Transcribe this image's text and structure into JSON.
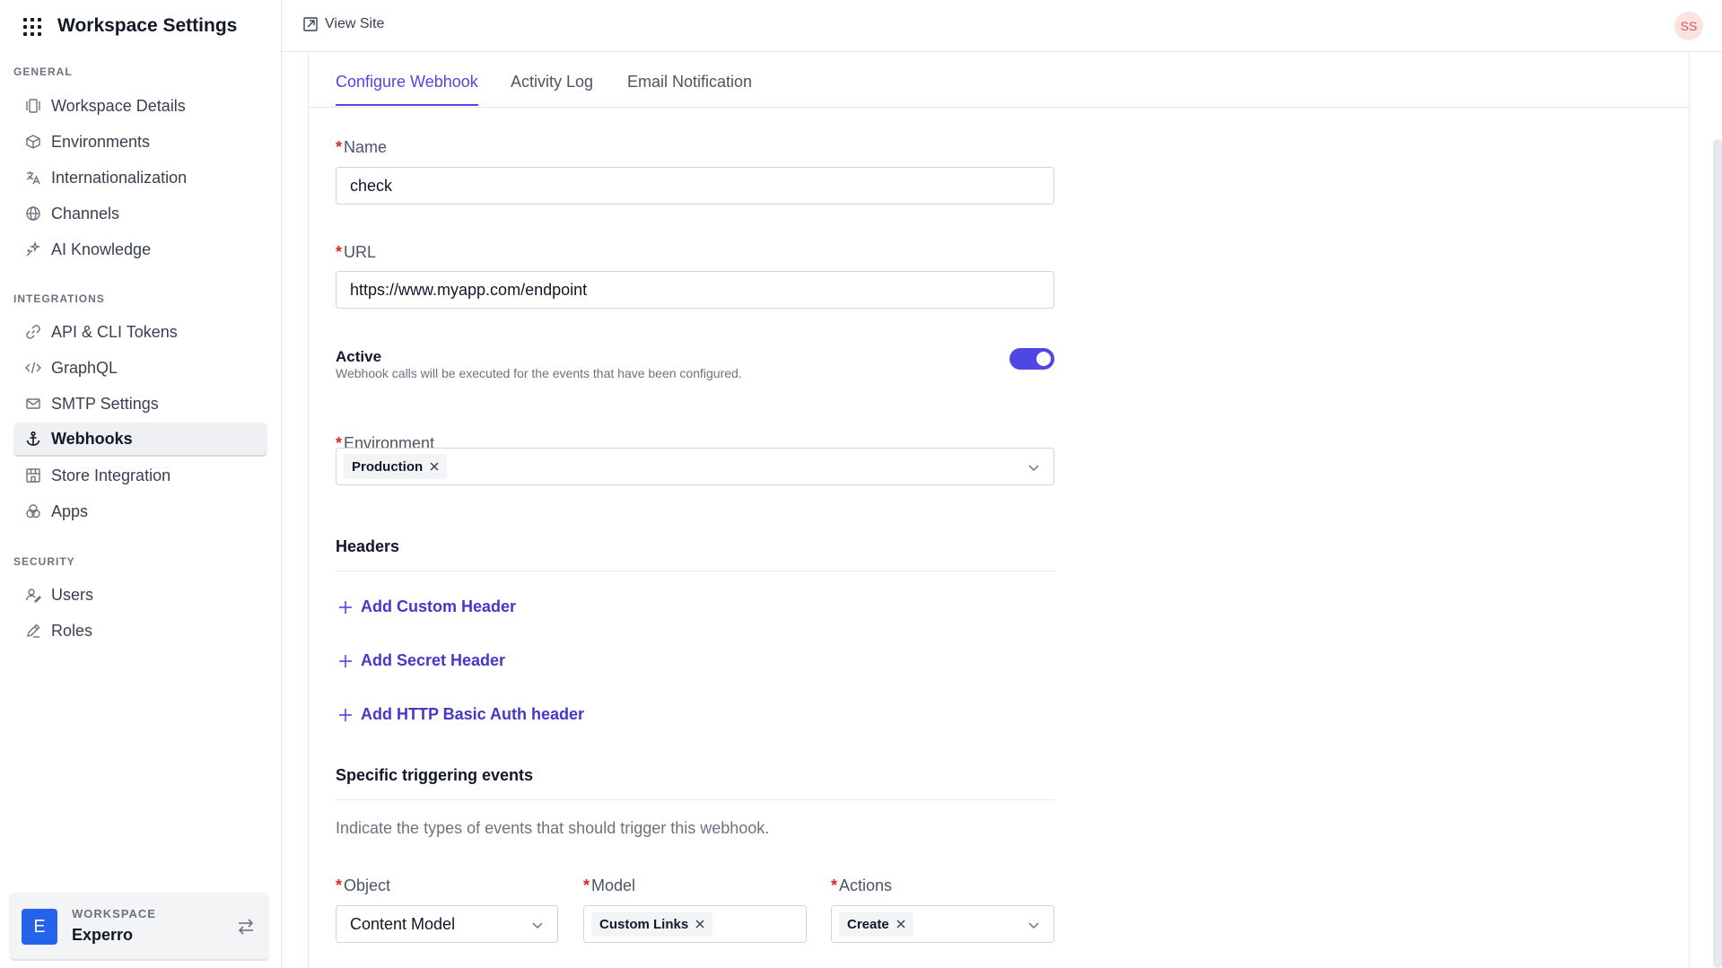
{
  "sidebar": {
    "title": "Workspace Settings",
    "sections": {
      "general": "GENERAL",
      "integrations": "INTEGRATIONS",
      "security": "SECURITY"
    },
    "items": [
      {
        "label": "Workspace Details",
        "icon": "panels-icon"
      },
      {
        "label": "Environments",
        "icon": "cube-icon"
      },
      {
        "label": "Internationalization",
        "icon": "translate-icon"
      },
      {
        "label": "Channels",
        "icon": "globe-icon"
      },
      {
        "label": "AI Knowledge",
        "icon": "sparkle-icon"
      },
      {
        "label": "API & CLI Tokens",
        "icon": "link-icon"
      },
      {
        "label": "GraphQL",
        "icon": "code-icon"
      },
      {
        "label": "SMTP Settings",
        "icon": "mail-icon"
      },
      {
        "label": "Webhooks",
        "icon": "anchor-icon",
        "active": true
      },
      {
        "label": "Store Integration",
        "icon": "store-icon"
      },
      {
        "label": "Apps",
        "icon": "apps-icon"
      },
      {
        "label": "Users",
        "icon": "users-icon"
      },
      {
        "label": "Roles",
        "icon": "pen-icon"
      }
    ],
    "workspace": {
      "label": "WORKSPACE",
      "name": "Experro",
      "initial": "E"
    }
  },
  "topbar": {
    "view_site": "View Site",
    "avatar_initials": "SS"
  },
  "tabs": [
    {
      "label": "Configure Webhook",
      "active": true
    },
    {
      "label": "Activity Log"
    },
    {
      "label": "Email Notification"
    }
  ],
  "form": {
    "required_mark": "*",
    "name": {
      "label": "Name",
      "value": "check"
    },
    "url": {
      "label": "URL",
      "value": "https://www.myapp.com/endpoint"
    },
    "active": {
      "label": "Active",
      "description": "Webhook calls will be executed for the events that have been configured.",
      "on": true
    },
    "environment": {
      "label": "Environment",
      "chips": [
        "Production"
      ]
    },
    "headers": {
      "title": "Headers",
      "add_custom": "Add Custom Header",
      "add_secret": "Add Secret Header",
      "add_basic_auth": "Add HTTP Basic Auth header"
    },
    "events": {
      "title": "Specific triggering events",
      "hint": "Indicate the types of events that should trigger this webhook.",
      "object": {
        "label": "Object",
        "value": "Content Model"
      },
      "model": {
        "label": "Model",
        "chips": [
          "Custom Links"
        ]
      },
      "actions": {
        "label": "Actions",
        "chips": [
          "Create"
        ]
      }
    }
  },
  "colors": {
    "accent": "#4f46e5",
    "required": "#dc2626",
    "workspace_avatar": "#2563eb"
  }
}
